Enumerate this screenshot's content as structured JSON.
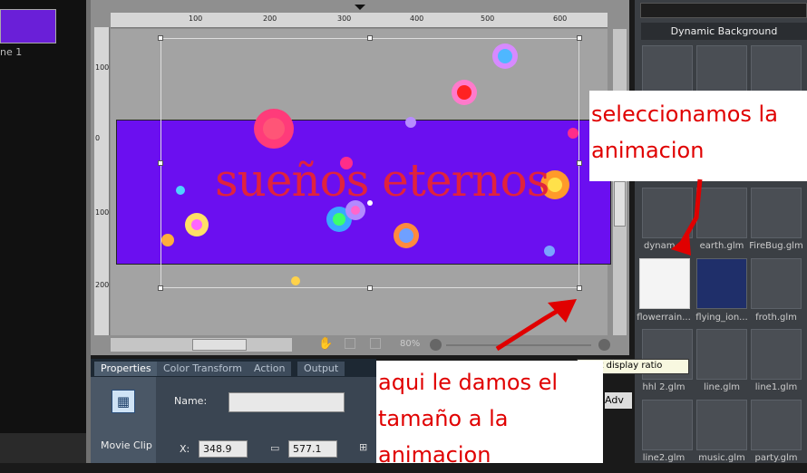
{
  "left_panel": {
    "scene_label": "ne 1"
  },
  "stage": {
    "banner_text": "sueños eternos",
    "top_ruler_ticks": [
      "100",
      "200",
      "300",
      "400",
      "500",
      "600"
    ],
    "left_ruler_ticks": [
      "100",
      "0",
      "100",
      "200"
    ],
    "zoom_label": "80%"
  },
  "properties": {
    "tabs": [
      "Properties",
      "Color Transform",
      "Action",
      "Output"
    ],
    "object_type": "Movie Clip",
    "name_label": "Name:",
    "name_value": "",
    "x_label": "X:",
    "x_value": "348.9",
    "width_value": "577.1"
  },
  "library": {
    "header": "Dynamic Background",
    "items": [
      {
        "name": "dynam..."
      },
      {
        "name": "earth.glm"
      },
      {
        "name": "FireBug.glm"
      },
      {
        "name": "flowerrain..."
      },
      {
        "name": "flying_ion..."
      },
      {
        "name": "froth.glm"
      },
      {
        "name": "hhl 2.glm"
      },
      {
        "name": "line.glm"
      },
      {
        "name": "line1.glm"
      },
      {
        "name": "line2.glm"
      },
      {
        "name": "music.glm"
      },
      {
        "name": "party.glm"
      }
    ]
  },
  "annotations": {
    "top": "seleccionamos la animacion",
    "bottom": "aqui le damos el tamaño a la animacion",
    "annotation_color": "#e00000"
  },
  "tooltip": "to set display ratio",
  "adv_label": "Adv",
  "colors": {
    "banner": "#6b0ff0",
    "banner_text": "#e0233d"
  }
}
